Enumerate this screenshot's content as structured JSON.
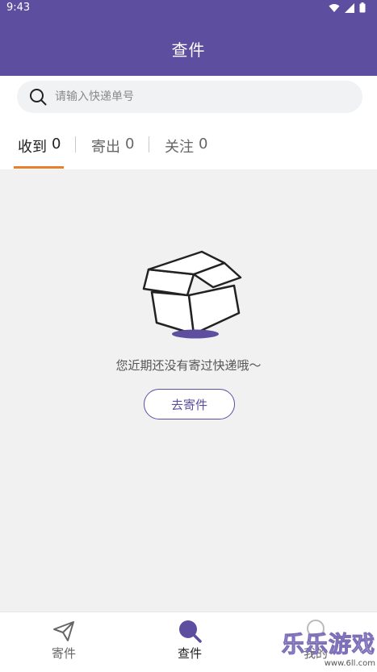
{
  "status_bar": {
    "time": "9:43"
  },
  "header": {
    "title": "查件"
  },
  "search": {
    "placeholder": "请输入快递单号"
  },
  "tabs": [
    {
      "label": "收到",
      "count": "0"
    },
    {
      "label": "寄出",
      "count": "0"
    },
    {
      "label": "关注",
      "count": "0"
    }
  ],
  "empty_state": {
    "message": "您近期还没有寄过快递哦～",
    "button_label": "去寄件"
  },
  "bottom_nav": [
    {
      "label": "寄件",
      "icon": "paper-plane-icon"
    },
    {
      "label": "查件",
      "icon": "search-icon"
    },
    {
      "label": "我的",
      "icon": "user-icon"
    }
  ],
  "watermark": {
    "text": "乐乐游戏",
    "url": "www.6ll.com"
  },
  "colors": {
    "primary": "#5d4ea0",
    "accent": "#e87f2b",
    "background": "#f1f1f1"
  }
}
